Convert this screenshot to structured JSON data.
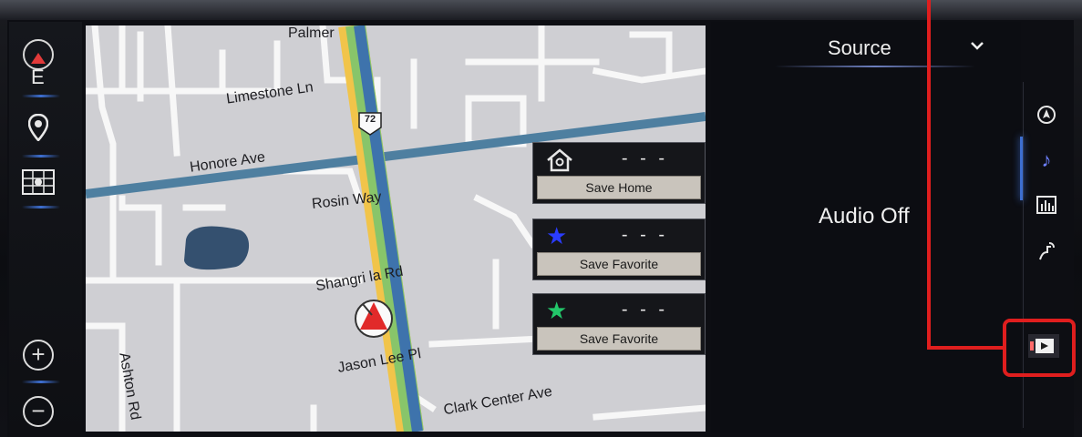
{
  "map": {
    "roads": {
      "palmer": "Palmer",
      "limestone": "Limestone Ln",
      "route_shield": "72",
      "honore": "Honore Ave",
      "rosin": "Rosin Way",
      "shangri": "Shangri la Rd",
      "ashton": "Ashton Rd",
      "jason": "Jason Lee Pl",
      "clark": "Clark Center Ave"
    }
  },
  "left_controls": {
    "compass_heading": "E",
    "zoom_in": "+",
    "zoom_out": "−"
  },
  "destinations": [
    {
      "icon": "home-icon",
      "value": "- - -",
      "button_label": "Save Home",
      "color": "#e0e0e0"
    },
    {
      "icon": "star-icon",
      "value": "- - -",
      "button_label": "Save Favorite",
      "color": "#2a3cff"
    },
    {
      "icon": "star-icon",
      "value": "- - -",
      "button_label": "Save Favorite",
      "color": "#23c76a"
    }
  ],
  "audio": {
    "source_label": "Source",
    "status": "Audio Off"
  },
  "side_menu": [
    {
      "icon": "navigation-icon",
      "active": false
    },
    {
      "icon": "music-note-icon",
      "active": true
    },
    {
      "icon": "equalizer-icon",
      "active": false
    },
    {
      "icon": "climate-icon",
      "active": false
    },
    {
      "icon": "media-screen-icon",
      "active": false
    }
  ],
  "annotation_color": "#e01e1e"
}
